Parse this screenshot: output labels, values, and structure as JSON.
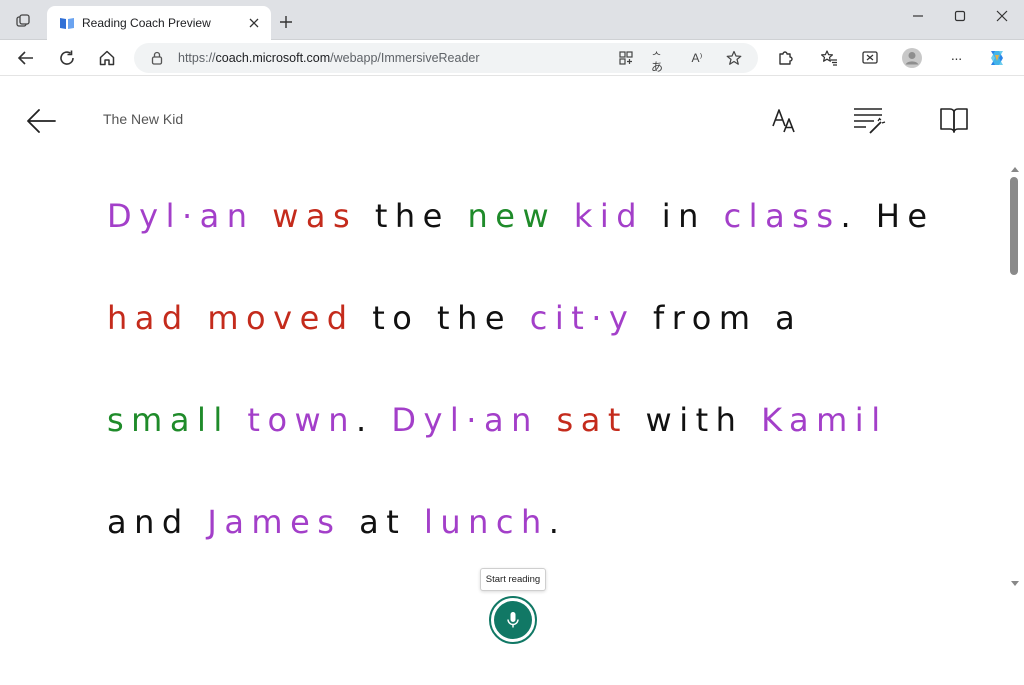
{
  "browser": {
    "tab_title": "Reading Coach Preview",
    "url_prefix": "https://",
    "url_domain": "coach.microsoft.com",
    "url_path": "/webapp/ImmersiveReader",
    "icons": [
      "workspaces-icon",
      "tab-favicon",
      "close-icon",
      "plus-icon",
      "minimize-icon",
      "maximize-icon",
      "window-close-icon",
      "back-icon",
      "refresh-icon",
      "home-icon",
      "lock-icon",
      "app-available-icon",
      "translate-icon",
      "read-aloud-icon",
      "favorite-star-icon",
      "extensions-icon",
      "favorites-icon",
      "screenshot-icon",
      "profile-icon",
      "more-icon",
      "copilot-icon"
    ],
    "translate_glyph": "ᆺあ",
    "read_aloud_glyph": "A⁾",
    "more_glyph": "···"
  },
  "app": {
    "doc_title": "The New Kid",
    "header_icons": [
      "back-arrow-icon",
      "text-preferences-icon",
      "grammar-options-icon",
      "reading-preferences-icon"
    ]
  },
  "reading": {
    "lines": [
      [
        {
          "text": "Dyl·an",
          "color": "#a33fc9"
        },
        {
          "text": "was",
          "color": "#c42b1c"
        },
        {
          "text": "the",
          "color": "#111111"
        },
        {
          "text": "new",
          "color": "#1f8b2a"
        },
        {
          "text": "kid",
          "color": "#a33fc9"
        },
        {
          "text": "in",
          "color": "#111111"
        },
        {
          "text": "class",
          "color": "#a33fc9"
        },
        {
          "text": ".",
          "color": "#111111"
        },
        {
          "text": "He",
          "color": "#111111"
        }
      ],
      [
        {
          "text": "had",
          "color": "#c42b1c"
        },
        {
          "text": "moved",
          "color": "#c42b1c"
        },
        {
          "text": "to",
          "color": "#111111"
        },
        {
          "text": "the",
          "color": "#111111"
        },
        {
          "text": "cit·y",
          "color": "#a33fc9"
        },
        {
          "text": "from",
          "color": "#111111"
        },
        {
          "text": "a",
          "color": "#111111"
        }
      ],
      [
        {
          "text": "small",
          "color": "#1f8b2a"
        },
        {
          "text": "town",
          "color": "#a33fc9"
        },
        {
          "text": ".",
          "color": "#111111"
        },
        {
          "text": "Dyl·an",
          "color": "#a33fc9"
        },
        {
          "text": "sat",
          "color": "#c42b1c"
        },
        {
          "text": "with",
          "color": "#111111"
        },
        {
          "text": "Kamil",
          "color": "#a33fc9"
        }
      ],
      [
        {
          "text": "and",
          "color": "#111111"
        },
        {
          "text": "James",
          "color": "#a33fc9"
        },
        {
          "text": "at",
          "color": "#111111"
        },
        {
          "text": "lunch",
          "color": "#a33fc9"
        },
        {
          "text": ".",
          "color": "#111111"
        }
      ]
    ]
  },
  "mic": {
    "tooltip": "Start reading",
    "accent": "#117865"
  }
}
